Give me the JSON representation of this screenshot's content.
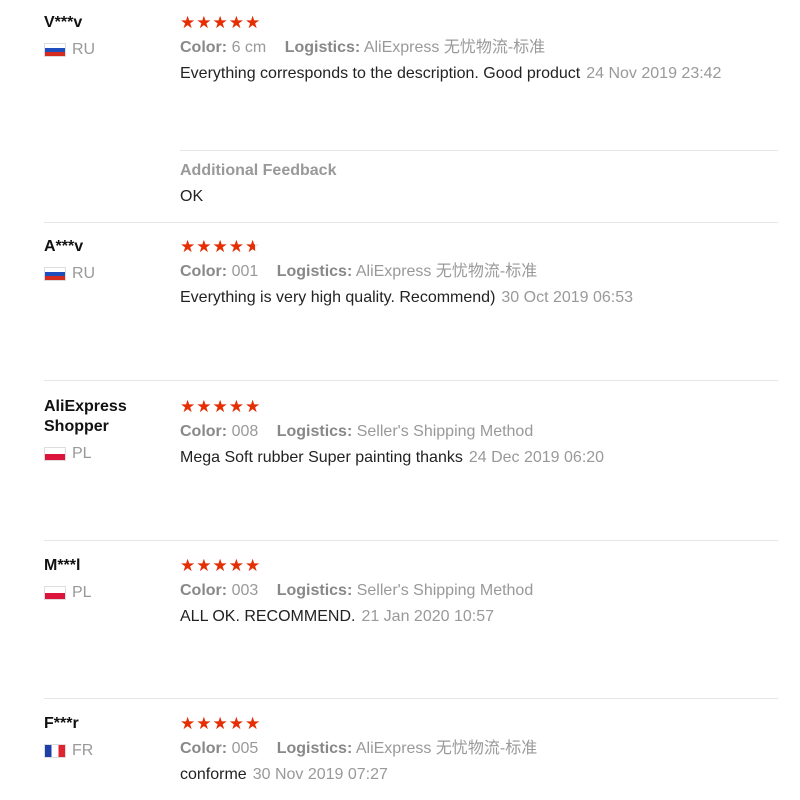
{
  "labels": {
    "color": "Color:",
    "logistics": "Logistics:",
    "additional_feedback": "Additional Feedback"
  },
  "colors": {
    "star": "#e62e04",
    "muted_text": "#999999",
    "divider": "#e6e6e6"
  },
  "reviews": [
    {
      "user": "V***v",
      "country": "RU",
      "rating": 5,
      "color": "6 cm",
      "logistics": "AliExpress 无忧物流-标准",
      "text": "Everything corresponds to the description. Good product",
      "date": "24 Nov 2019 23:42",
      "additional_feedback": "OK"
    },
    {
      "user": "A***v",
      "country": "RU",
      "rating": 4.6,
      "color": "001",
      "logistics": "AliExpress 无忧物流-标准",
      "text": "Everything is very high quality. Recommend)",
      "date": "30 Oct 2019 06:53"
    },
    {
      "user": "AliExpress Shopper",
      "country": "PL",
      "rating": 5,
      "color": "008",
      "logistics": "Seller's Shipping Method",
      "text": "Mega Soft rubber Super painting thanks",
      "date": "24 Dec 2019 06:20"
    },
    {
      "user": "M***l",
      "country": "PL",
      "rating": 5,
      "color": "003",
      "logistics": "Seller's Shipping Method",
      "text": "ALL OK. RECOMMEND.",
      "date": "21 Jan 2020 10:57"
    },
    {
      "user": "F***r",
      "country": "FR",
      "rating": 5,
      "color": "005",
      "logistics": "AliExpress 无忧物流-标准",
      "text": "conforme",
      "date": "30 Nov 2019 07:27"
    }
  ]
}
